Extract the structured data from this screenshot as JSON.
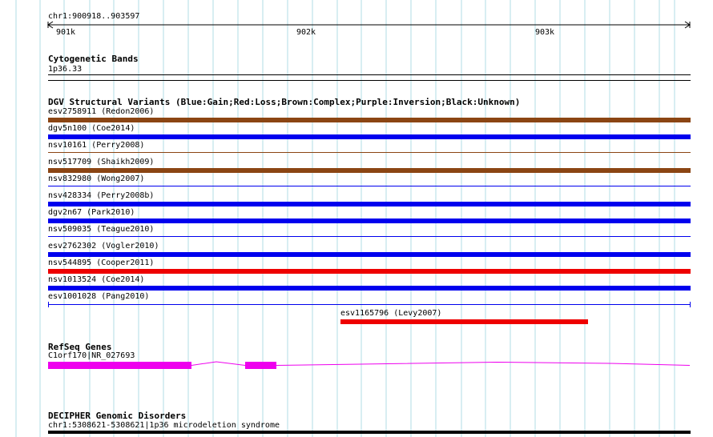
{
  "ruler": {
    "region": "chr1:900918..903597",
    "ticks": [
      "901k",
      "902k",
      "903k"
    ]
  },
  "cytoband": {
    "title": "Cytogenetic Bands",
    "band": "1p36.33"
  },
  "dgv": {
    "title": "DGV Structural Variants (Blue:Gain;Red:Loss;Brown:Complex;Purple:Inversion;Black:Unknown)",
    "variants": [
      {
        "label": "esv2758911 (Redon2006)",
        "type": "Complex"
      },
      {
        "label": "dgv5n100 (Coe2014)",
        "type": "Gain"
      },
      {
        "label": "nsv10161 (Perry2008)",
        "type": "Complex"
      },
      {
        "label": "nsv517709 (Shaikh2009)",
        "type": "Complex"
      },
      {
        "label": "nsv832980 (Wong2007)",
        "type": "Gain"
      },
      {
        "label": "nsv428334 (Perry2008b)",
        "type": "Gain"
      },
      {
        "label": "dgv2n67 (Park2010)",
        "type": "Gain"
      },
      {
        "label": "nsv509035 (Teague2010)",
        "type": "Gain"
      },
      {
        "label": "esv2762302 (Vogler2010)",
        "type": "Gain"
      },
      {
        "label": "nsv544895 (Cooper2011)",
        "type": "Loss"
      },
      {
        "label": "nsv1013524 (Coe2014)",
        "type": "Gain"
      },
      {
        "label": "esv1001028 (Pang2010)",
        "type": "Gain"
      },
      {
        "label": "esv1165796 (Levy2007)",
        "type": "Loss"
      }
    ],
    "colors": {
      "Gain": "#0000ee",
      "Loss": "#ee0000",
      "Complex": "#8b4513"
    }
  },
  "refseq": {
    "title": "RefSeq Genes",
    "gene": "C1orf170|NR_027693",
    "color": "#ee00ee"
  },
  "decipher": {
    "title": "DECIPHER Genomic Disorders",
    "entry": "chr1:5308621-5308621|1p36 microdeletion syndrome"
  },
  "colors": {
    "grid": "#b0dde6",
    "text": "#000000"
  }
}
